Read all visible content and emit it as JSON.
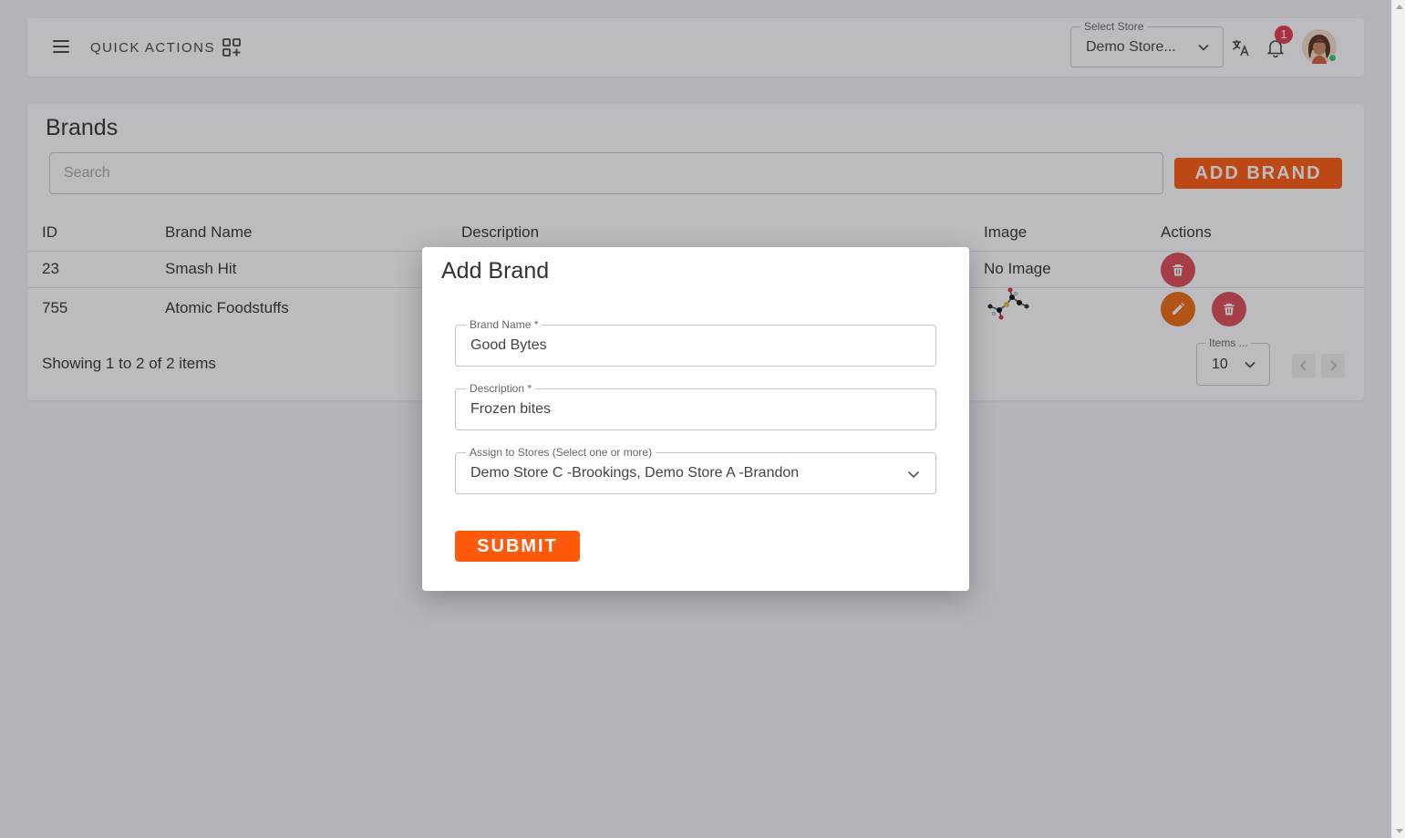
{
  "topbar": {
    "quick_actions_label": "QUICK ACTIONS",
    "store_select": {
      "legend": "Select Store",
      "value": "Demo Store..."
    },
    "notification_count": "1"
  },
  "brands": {
    "title": "Brands",
    "search_placeholder": "Search",
    "add_button_label": "ADD BRAND",
    "columns": {
      "id": "ID",
      "name": "Brand Name",
      "description": "Description",
      "image": "Image",
      "actions": "Actions"
    },
    "rows": [
      {
        "id": "23",
        "name": "Smash Hit",
        "image": "No Image"
      },
      {
        "id": "755",
        "name": "Atomic Foodstuffs",
        "image": ""
      }
    ],
    "showing": "Showing 1 to 2 of 2 items",
    "items_per_page": {
      "legend": "Items ...",
      "value": "10"
    }
  },
  "modal": {
    "title": "Add Brand",
    "brand_name": {
      "legend": "Brand Name *",
      "value": "Good Bytes"
    },
    "description": {
      "legend": "Description *",
      "value": "Frozen bites"
    },
    "stores": {
      "legend": "Assign to Stores (Select one or more)",
      "value": "Demo Store C -Brookings, Demo Store A -Brandon"
    },
    "submit_label": "SUBMIT"
  },
  "colors": {
    "accent": "#ff5a0b",
    "delete": "#e04b55",
    "edit": "#f06a0c",
    "badge": "#e53945"
  }
}
